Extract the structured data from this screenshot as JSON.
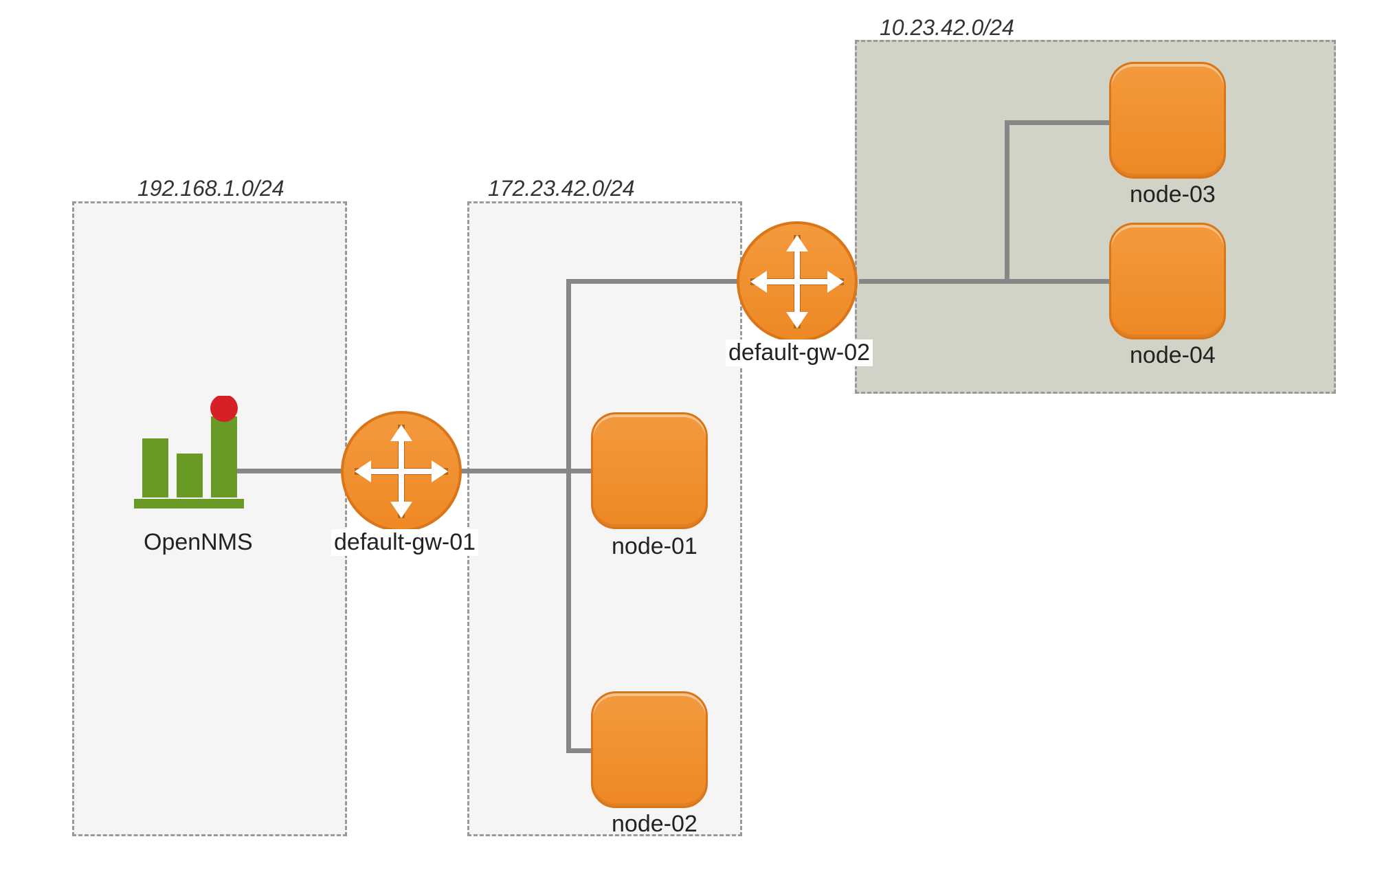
{
  "subnets": {
    "s1": {
      "label": "192.168.1.0/24"
    },
    "s2": {
      "label": "172.23.42.0/24"
    },
    "s3": {
      "label": "10.23.42.0/24"
    }
  },
  "nodes": {
    "opennms": {
      "label": "OpenNMS"
    },
    "gw1": {
      "label": "default-gw-01"
    },
    "gw2": {
      "label": "default-gw-02"
    },
    "n1": {
      "label": "node-01"
    },
    "n2": {
      "label": "node-02"
    },
    "n3": {
      "label": "node-03"
    },
    "n4": {
      "label": "node-04"
    }
  },
  "colors": {
    "node_fill": "#ee8824",
    "line": "#878787",
    "opennms_green": "#6a9a26",
    "opennms_red": "#d71f26"
  }
}
